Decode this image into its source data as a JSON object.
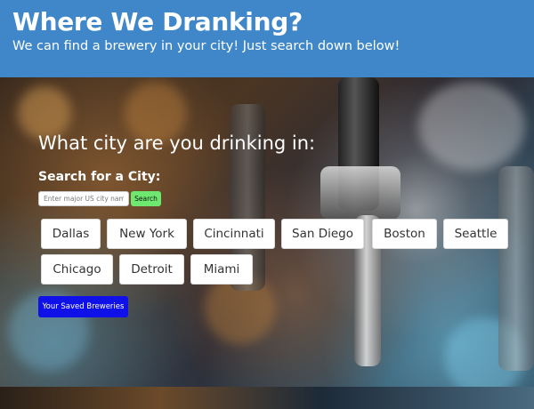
{
  "header": {
    "title": "Where We Dranking?",
    "subtitle": "We can find a brewery in your city! Just search down below!"
  },
  "main": {
    "question": "What city are you drinking in:",
    "search_label": "Search for a City:",
    "search_placeholder": "Enter major US city name",
    "search_button": "Search",
    "saved_button": "Your Saved Breweries"
  },
  "cities": [
    "Dallas",
    "New York",
    "Cincinnati",
    "San Diego",
    "Boston",
    "Seattle",
    "Chicago",
    "Detroit",
    "Miami"
  ],
  "colors": {
    "header_bg": "#3f87c9",
    "search_button_bg": "#6ee86e",
    "saved_button_bg": "#1010e8"
  }
}
